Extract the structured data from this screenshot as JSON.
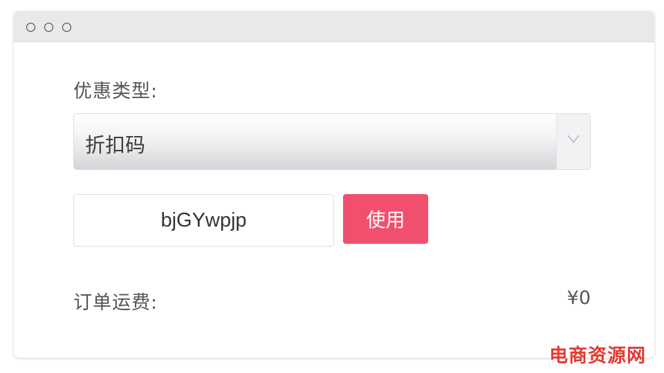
{
  "window": {
    "controls": [
      "circle",
      "circle",
      "circle"
    ]
  },
  "coupon": {
    "type_label": "优惠类型:",
    "selected_type": "折扣码",
    "code_value": "bjGYwpjp",
    "use_button_label": "使用"
  },
  "shipping": {
    "label": "订单运费:",
    "amount": "¥0"
  },
  "watermark": {
    "text": "电商资源网"
  },
  "colors": {
    "accent": "#f0506e",
    "titlebar": "#e9e8eb",
    "text": "#555555",
    "watermark": "#e03b35"
  },
  "icons": {
    "select_arrow": "chevron-down-icon"
  }
}
